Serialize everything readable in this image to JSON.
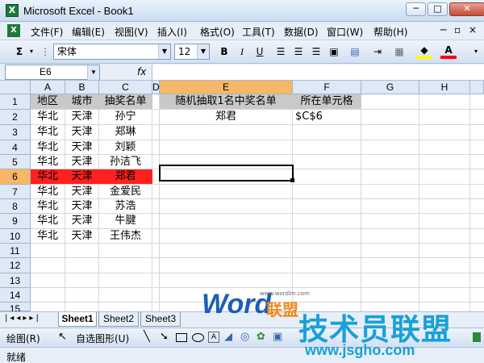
{
  "window": {
    "title": "Microsoft Excel - Book1",
    "app_icon": "X",
    "min": "─",
    "max": "□",
    "close": "✕"
  },
  "menu": {
    "items": [
      "文件(F)",
      "编辑(E)",
      "视图(V)",
      "插入(I)",
      "格式(O)",
      "工具(T)",
      "数据(D)",
      "窗口(W)",
      "帮助(H)"
    ],
    "doc_min": "─",
    "doc_restore": "▫",
    "doc_close": "×"
  },
  "toolbar": {
    "sigma": "Σ",
    "font": "宋体",
    "size": "12",
    "bold": "B",
    "italic": "I",
    "underline": "U"
  },
  "formula_bar": {
    "name_box": "E6",
    "fx": "fx",
    "formula": ""
  },
  "columns": [
    "A",
    "B",
    "C",
    "D",
    "E",
    "F",
    "G",
    "H"
  ],
  "rows": [
    "1",
    "2",
    "3",
    "4",
    "5",
    "6",
    "7",
    "8",
    "9",
    "10",
    "11",
    "12",
    "13",
    "14",
    "15"
  ],
  "cells": {
    "a1": "地区",
    "b1": "城市",
    "c1": "抽奖名单",
    "e1": "随机抽取1名中奖名单",
    "f1": "所在单元格",
    "a2": "华北",
    "b2": "天津",
    "c2": "孙宁",
    "e2": "郑君",
    "f2": "$C$6",
    "a3": "华北",
    "b3": "天津",
    "c3": "郑琳",
    "a4": "华北",
    "b4": "天津",
    "c4": "刘颖",
    "a5": "华北",
    "b5": "天津",
    "c5": "孙洁飞",
    "a6": "华北",
    "b6": "天津",
    "c6": "郑君",
    "a7": "华北",
    "b7": "天津",
    "c7": "金爱民",
    "a8": "华北",
    "b8": "天津",
    "c8": "苏浩",
    "a9": "华北",
    "b9": "天津",
    "c9": "牛腱",
    "a10": "华北",
    "b10": "天津",
    "c10": "王伟杰"
  },
  "sheets": [
    "Sheet1",
    "Sheet2",
    "Sheet3"
  ],
  "drawbar": {
    "draw": "绘图(R)",
    "autoshapes": "自选图形(U)"
  },
  "status": "就绪",
  "watermark": {
    "word": "Word",
    "union": "联盟",
    "site1": "www.wordlm.com",
    "brand": "技术员联盟",
    "site2": "www.jsgho.com"
  },
  "colors": {
    "highlight": "#ff2020",
    "header_selected": "#f7b766"
  }
}
